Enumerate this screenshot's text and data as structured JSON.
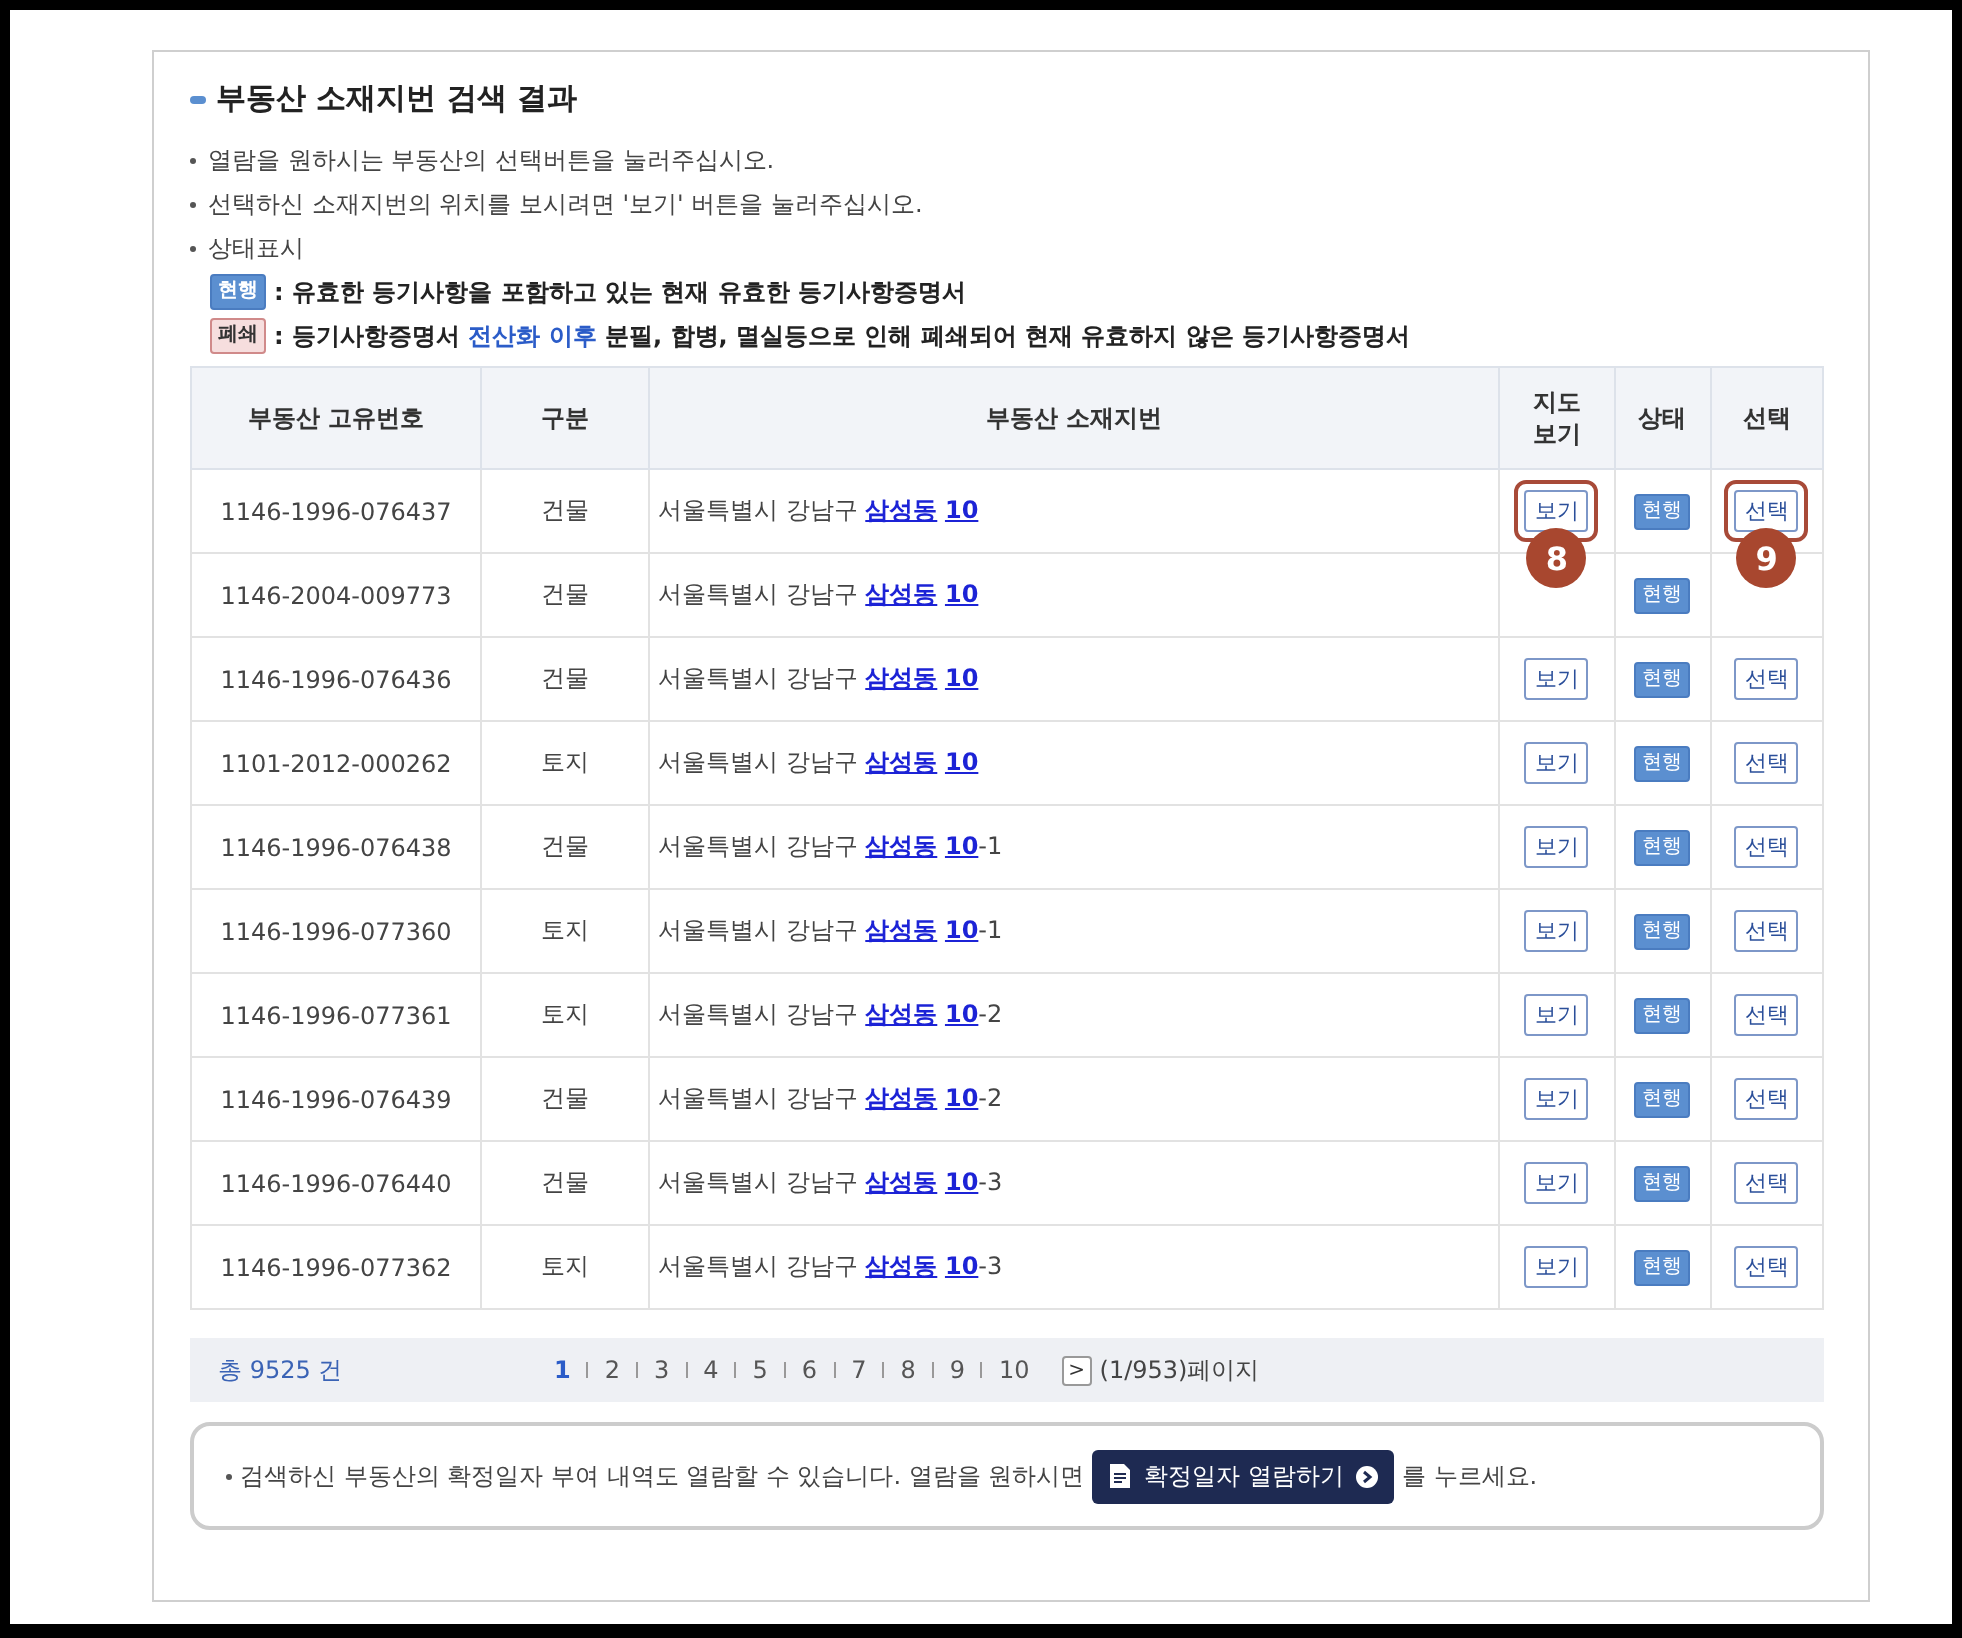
{
  "title": "부동산 소재지번 검색 결과",
  "notes": [
    "열람을 원하시는 부동산의 선택버튼을 눌러주십시오.",
    "선택하신 소재지번의 위치를 보시려면 '보기' 버튼을 눌러주십시오.",
    "상태표시"
  ],
  "legend": [
    {
      "badge": "현행",
      "kind": "current",
      "text_before": ": 유효한 등기사항을 포함하고 있는 현재 유효한 등기사항증명서"
    },
    {
      "badge": "폐쇄",
      "kind": "closed",
      "text_before": ": 등기사항증명서 ",
      "highlight": "전산화 이후",
      "text_after": " 분필, 합병, 멸실등으로 인해 폐쇄되어 현재 유효하지 않은 등기사항증명서"
    }
  ],
  "table": {
    "columns": [
      "부동산 고유번호",
      "구분",
      "부동산 소재지번",
      "지도\n보기",
      "상태",
      "선택"
    ],
    "rows": [
      {
        "id": "1146-1996-076437",
        "type": "건물",
        "address": "서울특별시 강남구 ",
        "dong": "삼성동",
        "lot": "10",
        "map_button": "보기",
        "status": {
          "label": "현행",
          "kind": "current"
        },
        "select_button": "선택",
        "map_callout": "8",
        "select_callout": "9"
      },
      {
        "id": "1146-2004-009773",
        "type": "건물",
        "address": "서울특별시 강남구 ",
        "dong": "삼성동",
        "lot": "10",
        "status": {
          "label": "현행",
          "kind": "current"
        }
      },
      {
        "id": "1146-1996-076436",
        "type": "건물",
        "address": "서울특별시 강남구 ",
        "dong": "삼성동",
        "lot": "10",
        "map_button": "보기",
        "status": {
          "label": "현행",
          "kind": "current"
        },
        "select_button": "선택"
      },
      {
        "id": "1101-2012-000262",
        "type": "토지",
        "address": "서울특별시 강남구 ",
        "dong": "삼성동",
        "lot": "10",
        "map_button": "보기",
        "status": {
          "label": "현행",
          "kind": "current"
        },
        "select_button": "선택"
      },
      {
        "id": "1146-1996-076438",
        "type": "건물",
        "address": "서울특별시 강남구 ",
        "dong": "삼성동",
        "lot": "10",
        "suffix": "-1",
        "map_button": "보기",
        "status": {
          "label": "현행",
          "kind": "current"
        },
        "select_button": "선택"
      },
      {
        "id": "1146-1996-077360",
        "type": "토지",
        "address": "서울특별시 강남구 ",
        "dong": "삼성동",
        "lot": "10",
        "suffix": "-1",
        "map_button": "보기",
        "status": {
          "label": "현행",
          "kind": "current"
        },
        "select_button": "선택"
      },
      {
        "id": "1146-1996-077361",
        "type": "토지",
        "address": "서울특별시 강남구 ",
        "dong": "삼성동",
        "lot": "10",
        "suffix": "-2",
        "map_button": "보기",
        "status": {
          "label": "현행",
          "kind": "current"
        },
        "select_button": "선택"
      },
      {
        "id": "1146-1996-076439",
        "type": "건물",
        "address": "서울특별시 강남구 ",
        "dong": "삼성동",
        "lot": "10",
        "suffix": "-2",
        "map_button": "보기",
        "status": {
          "label": "현행",
          "kind": "current"
        },
        "select_button": "선택"
      },
      {
        "id": "1146-1996-076440",
        "type": "건물",
        "address": "서울특별시 강남구 ",
        "dong": "삼성동",
        "lot": "10",
        "suffix": "-3",
        "map_button": "보기",
        "status": {
          "label": "현행",
          "kind": "current"
        },
        "select_button": "선택"
      },
      {
        "id": "1146-1996-077362",
        "type": "토지",
        "address": "서울특별시 강남구 ",
        "dong": "삼성동",
        "lot": "10",
        "suffix": "-3",
        "map_button": "보기",
        "status": {
          "label": "현행",
          "kind": "current"
        },
        "select_button": "선택"
      }
    ]
  },
  "pager": {
    "total": "총 9525 건",
    "pages": [
      {
        "label": "1",
        "selected": true
      },
      {
        "label": "2",
        "selected": false
      },
      {
        "label": "3",
        "selected": false
      },
      {
        "label": "4",
        "selected": false
      },
      {
        "label": "5",
        "selected": false
      },
      {
        "label": "6",
        "selected": false
      },
      {
        "label": "7",
        "selected": false
      },
      {
        "label": "8",
        "selected": false
      },
      {
        "label": "9",
        "selected": false
      },
      {
        "label": "10",
        "selected": false
      }
    ],
    "next": ">",
    "page_info": "(1/953)페이지"
  },
  "notice": {
    "text_before": "검색하신 부동산의 확정일자 부여 내역도 열람할 수 있습니다. 열람을 원하시면",
    "button": "확정일자 열람하기",
    "text_after": "를 누르세요."
  }
}
